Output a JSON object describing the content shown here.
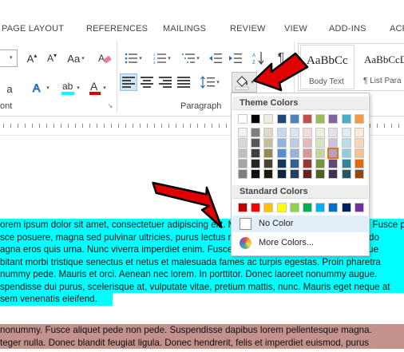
{
  "tabs": [
    "PAGE LAYOUT",
    "REFERENCES",
    "MAILINGS",
    "REVIEW",
    "VIEW",
    "ADD-INS",
    "ACR"
  ],
  "ribbon": {
    "group_font_label": "ont",
    "group_paragraph_label": "Paragraph",
    "styles": [
      {
        "sample": "AaBbCc",
        "name": "Body Text"
      },
      {
        "sample": "AaBbCcD",
        "name": "¶ List Para"
      }
    ]
  },
  "color_menu": {
    "theme_header": "Theme Colors",
    "standard_header": "Standard Colors",
    "no_color_label": "No Color",
    "more_colors_label": "More Colors...",
    "theme_top_row": [
      "#ffffff",
      "#000000",
      "#eeece1",
      "#1f497d",
      "#4f81bd",
      "#c0504d",
      "#9bbb59",
      "#8064a2",
      "#4bacc6",
      "#f79646"
    ],
    "theme_shades": [
      [
        "#f2f2f2",
        "#7f7f7f",
        "#ddd9c3",
        "#c6d9f0",
        "#dbe5f1",
        "#f2dcdb",
        "#ebf1dd",
        "#e5e0ec",
        "#dbeef3",
        "#fdeada"
      ],
      [
        "#d8d8d8",
        "#595959",
        "#c4bd97",
        "#8db3e2",
        "#b8cce4",
        "#e5b9b7",
        "#d7e3bc",
        "#ccc1d9",
        "#b7dde8",
        "#fbd5b5"
      ],
      [
        "#bfbfbf",
        "#3f3f3f",
        "#938953",
        "#548dd4",
        "#95b3d7",
        "#d99694",
        "#c3d69b",
        "#b2a2c7",
        "#92cddc",
        "#fac08f"
      ],
      [
        "#a5a5a5",
        "#262626",
        "#494429",
        "#17365d",
        "#366092",
        "#953734",
        "#76923c",
        "#5f497a",
        "#31859b",
        "#e36c09"
      ],
      [
        "#7f7f7f",
        "#0c0c0c",
        "#1d1b10",
        "#0f243e",
        "#244061",
        "#632423",
        "#4f6128",
        "#3f3151",
        "#205867",
        "#974806"
      ]
    ],
    "standard_colors": [
      "#c00000",
      "#ff0000",
      "#ffc000",
      "#ffff00",
      "#92d050",
      "#00b050",
      "#00b0f0",
      "#0070c0",
      "#002060",
      "#7030a0"
    ]
  },
  "document": {
    "cyan_lines": [
      "orem ipsum dolor sit amet, consectetuer adipiscing elit. Maecenas porttitor congue massa. Fusce posuere, magna sed pulvinar ultricies, purus lectus malesuada libero, sit amet commodo",
      "sce posuere, magna sed pulvinar ultricies, purus lectus malesuada libero, sit amet commodo",
      "agna eros quis urna. Nunc viverra imperdiet enim. Fusce est. Vivamus a tellus. Pellentesque",
      "bitant morbi tristique senectus et netus et malesuada fames ac turpis egestas. Proin pharetra",
      "nummy pede. Mauris et orci. Aenean nec lorem. In porttitor. Donec laoreet nonummy augue.",
      "spendisse dui purus, scelerisque at, vulputate vitae, pretium mattis, nunc. Mauris eget neque at",
      "sem venenatis eleifend."
    ],
    "brown_lines": [
      " nonummy. Fusce aliquet pede non pede. Suspendisse dapibus lorem pellentesque magna.",
      "teger nulla. Donec blandit feugiat ligula. Donec hendrerit, felis et imperdiet euismod, purus"
    ]
  },
  "colors": {
    "highlight_cyan": "#00ffff",
    "highlight_brown": "#c4928c",
    "arrow_red": "#e00000"
  },
  "icons": [
    "font-size-increase-icon",
    "font-size-decrease-icon",
    "change-case-icon",
    "clear-formatting-icon",
    "bullets-icon",
    "numbering-icon",
    "multilevel-list-icon",
    "decrease-indent-icon",
    "increase-indent-icon",
    "sort-icon",
    "show-formatting-icon",
    "align-left-icon",
    "center-icon",
    "align-right-icon",
    "justify-icon",
    "line-spacing-icon",
    "shading-icon",
    "highlight-icon",
    "font-color-icon",
    "dialog-launcher-icon",
    "color-wheel-icon"
  ]
}
